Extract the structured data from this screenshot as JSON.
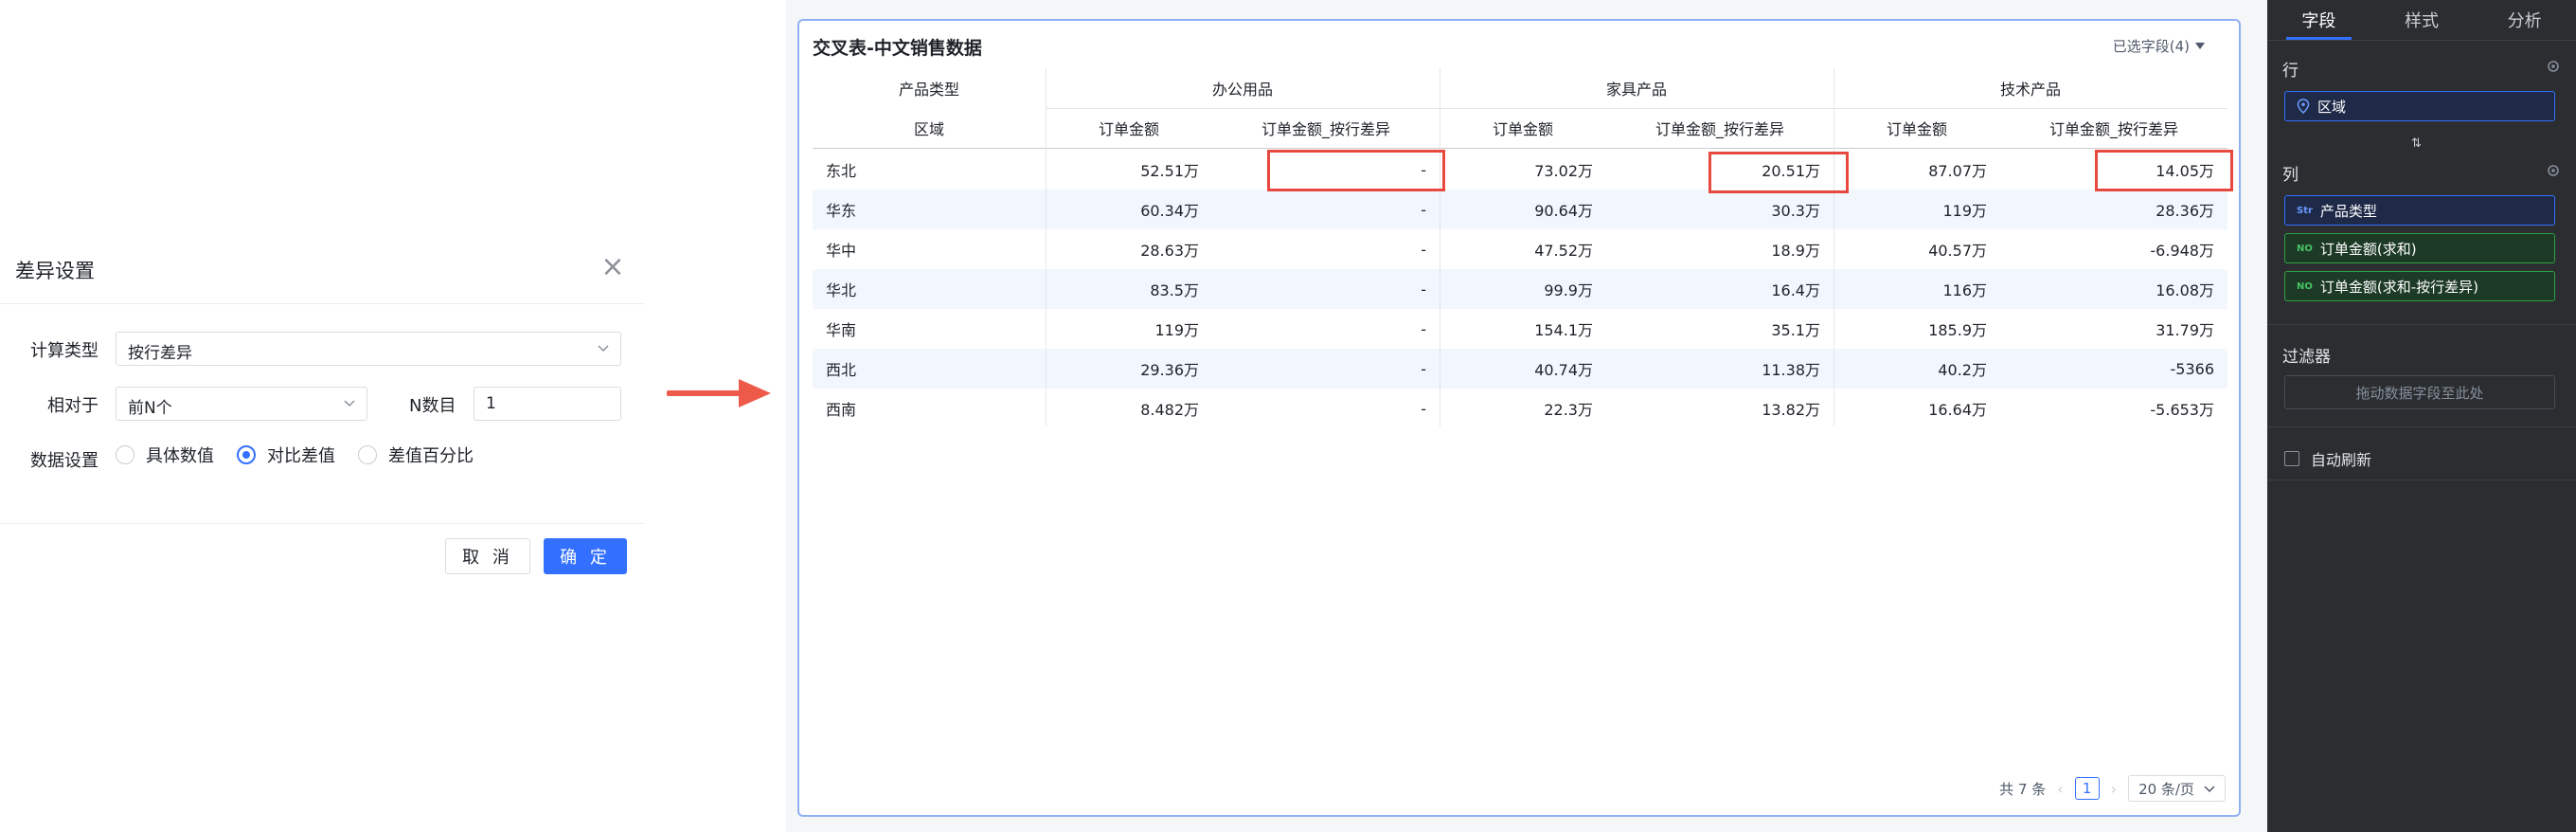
{
  "dialog": {
    "title": "差异设置",
    "calc_type_label": "计算类型",
    "calc_type_value": "按行差异",
    "relative_label": "相对于",
    "relative_value": "前N个",
    "n_label": "N数目",
    "n_value": "1",
    "data_setting_label": "数据设置",
    "radio_options": [
      "具体数值",
      "对比差值",
      "差值百分比"
    ],
    "radio_selected": 1,
    "cancel_label": "取 消",
    "ok_label": "确 定"
  },
  "table": {
    "title": "交叉表-中文销售数据",
    "fields_selector": "已选字段(4)",
    "row_header_top": "产品类型",
    "row_header": "区域",
    "groups": [
      "办公用品",
      "家具产品",
      "技术产品"
    ],
    "measure_headers": [
      "订单金额",
      "订单金额_按行差异"
    ],
    "rows": [
      {
        "region": "东北",
        "values": [
          "52.51万",
          "-",
          "73.02万",
          "20.51万",
          "87.07万",
          "14.05万"
        ]
      },
      {
        "region": "华东",
        "values": [
          "60.34万",
          "-",
          "90.64万",
          "30.3万",
          "119万",
          "28.36万"
        ]
      },
      {
        "region": "华中",
        "values": [
          "28.63万",
          "-",
          "47.52万",
          "18.9万",
          "40.57万",
          "-6.948万"
        ]
      },
      {
        "region": "华北",
        "values": [
          "83.5万",
          "-",
          "99.9万",
          "16.4万",
          "116万",
          "16.08万"
        ]
      },
      {
        "region": "华南",
        "values": [
          "119万",
          "-",
          "154.1万",
          "35.1万",
          "185.9万",
          "31.79万"
        ]
      },
      {
        "region": "西北",
        "values": [
          "29.36万",
          "-",
          "40.74万",
          "11.38万",
          "40.2万",
          "-5366"
        ]
      },
      {
        "region": "西南",
        "values": [
          "8.482万",
          "-",
          "22.3万",
          "13.82万",
          "16.64万",
          "-5.653万"
        ]
      }
    ],
    "pager": {
      "total": "共 7 条",
      "current_page": "1",
      "page_size": "20 条/页"
    }
  },
  "panel": {
    "tabs": [
      "字段",
      "样式",
      "分析"
    ],
    "active_tab": 0,
    "row_label": "行",
    "row_fields": [
      "区域"
    ],
    "col_label": "列",
    "col_dim_field": "产品类型",
    "col_measure_fields": [
      "订单金额(求和)",
      "订单金额(求和-按行差异)"
    ],
    "dim_tag": "Str",
    "measure_tag": "NO",
    "filter_label": "过滤器",
    "filter_placeholder": "拖动数据字段至此处",
    "auto_refresh": "自动刷新"
  },
  "colors": {
    "accent": "#3370ff",
    "highlight": "#e8493f",
    "panel_bg": "#2b2d31"
  }
}
